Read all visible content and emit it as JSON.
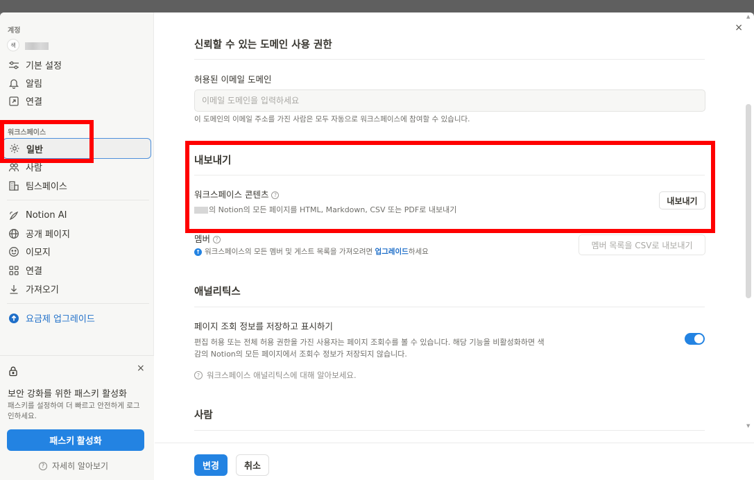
{
  "sidebar": {
    "account_label": "계정",
    "avatar_text": "색",
    "account_items": [
      "기본 설정",
      "알림",
      "연결"
    ],
    "workspace_label": "워크스페이스",
    "workspace_items": [
      "일반",
      "사람",
      "팀스페이스"
    ],
    "feature_items": [
      "Notion AI",
      "공개 페이지",
      "이모지",
      "연결",
      "가져오기"
    ],
    "upgrade_label": "요금제 업그레이드"
  },
  "passkey": {
    "close": "×",
    "title": "보안 강화를 위한 패스키 활성화",
    "description": "패스키를 설정하여 더 빠르고 안전하게 로그인하세요.",
    "button": "패스키 활성화",
    "learn_more": "자세히 알아보기"
  },
  "main": {
    "close": "×",
    "trusted_domain": {
      "title": "신뢰할 수 있는 도메인 사용 권한",
      "field_label": "허용된 이메일 도메인",
      "placeholder": "이메일 도메인을 입력하세요",
      "hint": "이 도메인의 이메일 주소를 가진 사람은 모두 자동으로 워크스페이스에 참여할 수 있습니다."
    },
    "export": {
      "title": "내보내기",
      "content_label": "워크스페이스 콘텐츠",
      "content_desc": "의 Notion의 모든 페이지를 HTML, Markdown, CSV 또는 PDF로 내보내기",
      "export_button": "내보내기",
      "members_label": "멤버",
      "members_desc_pre": "워크스페이스의 모든 멤버 및 게스트 목록을 가져오려면 ",
      "members_link": "업그레이드",
      "members_desc_post": "하세요",
      "members_button": "멤버 목록을 CSV로 내보내기"
    },
    "analytics": {
      "title": "애널리틱스",
      "toggle_label": "페이지 조회 정보를 저장하고 표시하기",
      "desc_line1": "편집 허용 또는 전체 허용 권한을 가진 사용자는 페이지 조회수를 볼 수 있습니다. 해당 기능을 비활성화하면 색",
      "desc_line2": "감의 Notion의 모든 페이지에서 조회수 정보가 저장되지 않습니다.",
      "learn_more": "워크스페이스 애널리틱스에 대해 알아보세요.",
      "toggle_on": true
    },
    "people": {
      "title": "사람"
    }
  },
  "footer": {
    "save": "변경",
    "cancel": "취소"
  },
  "colors": {
    "accent": "#2383e2",
    "highlight_box": "#ff0000"
  }
}
